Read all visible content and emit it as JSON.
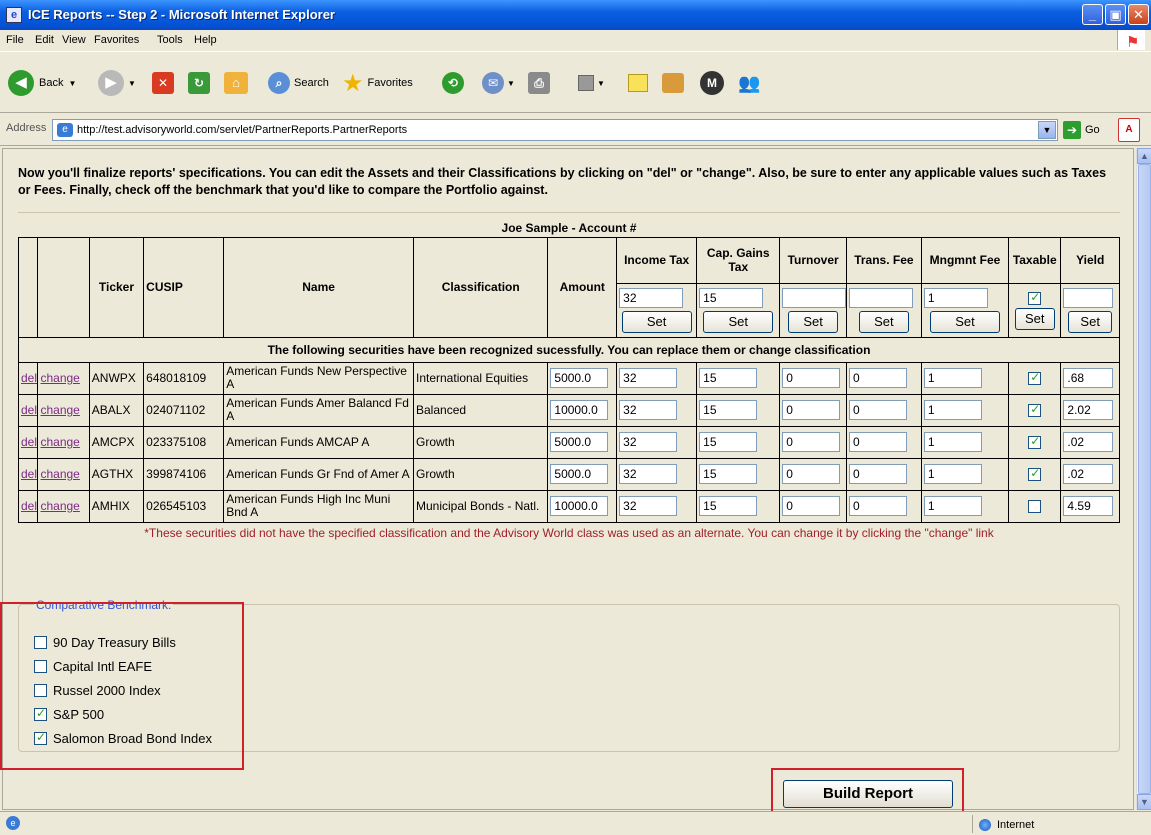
{
  "window": {
    "title": "ICE Reports -- Step 2 - Microsoft Internet Explorer"
  },
  "menu": [
    "File",
    "Edit",
    "View",
    "Favorites",
    "Tools",
    "Help"
  ],
  "toolbar": {
    "back": "Back",
    "search": "Search",
    "favorites": "Favorites"
  },
  "address": {
    "label": "Address",
    "url": "http://test.advisoryworld.com/servlet/PartnerReports.PartnerReports",
    "go": "Go"
  },
  "intro": "Now you'll finalize reports' specifications. You can edit the Assets and their Classifications by clicking on \"del\" or \"change\". Also, be sure to enter any applicable values such as Taxes or Fees. Finally, check off the benchmark that you'd like to compare the Portfolio against.",
  "table": {
    "caption": "Joe Sample - Account #",
    "headers": {
      "ticker": "Ticker",
      "cusip": "CUSIP",
      "name": "Name",
      "classification": "Classification",
      "amount": "Amount",
      "income_tax": "Income Tax",
      "cap_gains_tax": "Cap. Gains Tax",
      "turnover": "Turnover",
      "trans_fee": "Trans. Fee",
      "mngmnt_fee": "Mngmnt Fee",
      "taxable": "Taxable",
      "yield": "Yield"
    },
    "defaults": {
      "income_tax": "32",
      "cap_gains_tax": "15",
      "turnover": "",
      "trans_fee": "",
      "mngmnt_fee": "1",
      "yield": ""
    },
    "set_label": "Set",
    "notice": "The following securities have been recognized sucessfully. You can replace them or change classification",
    "del_label": "del",
    "change_label": "change",
    "rows": [
      {
        "ticker": "ANWPX",
        "cusip": "648018109",
        "name": "American Funds New Perspective A",
        "classification": "International Equities",
        "amount": "5000.0",
        "income_tax": "32",
        "cap_gains_tax": "15",
        "turnover": "0",
        "trans_fee": "0",
        "mngmnt_fee": "1",
        "taxable": true,
        "yield": ".68"
      },
      {
        "ticker": "ABALX",
        "cusip": "024071102",
        "name": "American Funds Amer Balancd Fd A",
        "classification": "Balanced",
        "amount": "10000.0",
        "income_tax": "32",
        "cap_gains_tax": "15",
        "turnover": "0",
        "trans_fee": "0",
        "mngmnt_fee": "1",
        "taxable": true,
        "yield": "2.02"
      },
      {
        "ticker": "AMCPX",
        "cusip": "023375108",
        "name": "American Funds AMCAP A",
        "classification": "Growth",
        "amount": "5000.0",
        "income_tax": "32",
        "cap_gains_tax": "15",
        "turnover": "0",
        "trans_fee": "0",
        "mngmnt_fee": "1",
        "taxable": true,
        "yield": ".02"
      },
      {
        "ticker": "AGTHX",
        "cusip": "399874106",
        "name": "American Funds Gr Fnd of Amer A",
        "classification": "Growth",
        "amount": "5000.0",
        "income_tax": "32",
        "cap_gains_tax": "15",
        "turnover": "0",
        "trans_fee": "0",
        "mngmnt_fee": "1",
        "taxable": true,
        "yield": ".02"
      },
      {
        "ticker": "AMHIX",
        "cusip": "026545103",
        "name": "American Funds High Inc Muni Bnd A",
        "classification": "Municipal Bonds - Natl.",
        "amount": "10000.0",
        "income_tax": "32",
        "cap_gains_tax": "15",
        "turnover": "0",
        "trans_fee": "0",
        "mngmnt_fee": "1",
        "taxable": false,
        "yield": "4.59"
      }
    ],
    "footnote": "*These securities did not have the specified classification and the Advisory World class was used as an alternate. You can change it by clicking the \"change\" link"
  },
  "benchmark": {
    "legend": "Comparative Benchmark:",
    "items": [
      {
        "label": "90 Day Treasury Bills",
        "checked": false
      },
      {
        "label": "Capital Intl EAFE",
        "checked": false
      },
      {
        "label": "Russel 2000 Index",
        "checked": false
      },
      {
        "label": "S&P 500",
        "checked": true
      },
      {
        "label": "Salomon Broad Bond Index",
        "checked": true
      }
    ]
  },
  "build_button": "Build Report",
  "status": {
    "zone": "Internet"
  },
  "colors": {
    "title_blue": "#0a5fe0",
    "highlight_red": "#d0202a",
    "link_purple": "#7b2a8c",
    "legend_blue": "#3355d0"
  }
}
